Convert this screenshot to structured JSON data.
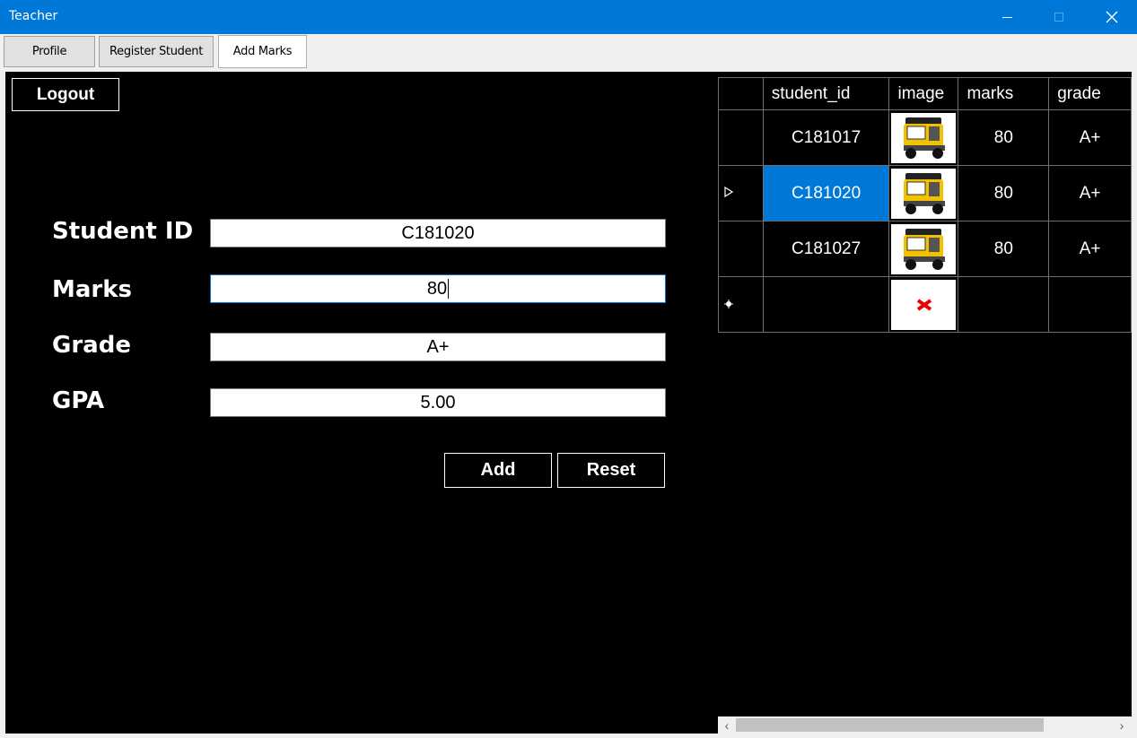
{
  "window": {
    "title": "Teacher",
    "accent_color": "#0078d7",
    "controls": [
      "minimize-icon",
      "maximize-icon",
      "close-icon"
    ]
  },
  "tabs": [
    {
      "label": "Profile",
      "selected": false
    },
    {
      "label": "Register Student",
      "selected": false
    },
    {
      "label": "Add Marks",
      "selected": true
    }
  ],
  "form": {
    "logout_label": "Logout",
    "student_id": {
      "label": "Student ID",
      "value": "C181020"
    },
    "marks": {
      "label": "Marks",
      "value": "80"
    },
    "grade": {
      "label": "Grade",
      "value": "A+"
    },
    "gpa": {
      "label": "GPA",
      "value": "5.00"
    },
    "add_label": "Add",
    "reset_label": "Reset"
  },
  "grid": {
    "columns": [
      "student_id",
      "image",
      "marks",
      "grade"
    ],
    "rows": [
      {
        "student_id": "C181017",
        "image": "auto-rickshaw-image",
        "marks": "80",
        "grade": "A+",
        "selected": false
      },
      {
        "student_id": "C181020",
        "image": "auto-rickshaw-image",
        "marks": "80",
        "grade": "A+",
        "selected": true
      },
      {
        "student_id": "C181027",
        "image": "auto-rickshaw-image",
        "marks": "80",
        "grade": "A+",
        "selected": false
      }
    ],
    "new_row": {
      "image": "broken-image-icon"
    },
    "selected_row_marker": "current-row-arrow-icon",
    "new_row_marker": "new-row-icon",
    "horizontal_scrollbar": {
      "visible": true
    }
  }
}
